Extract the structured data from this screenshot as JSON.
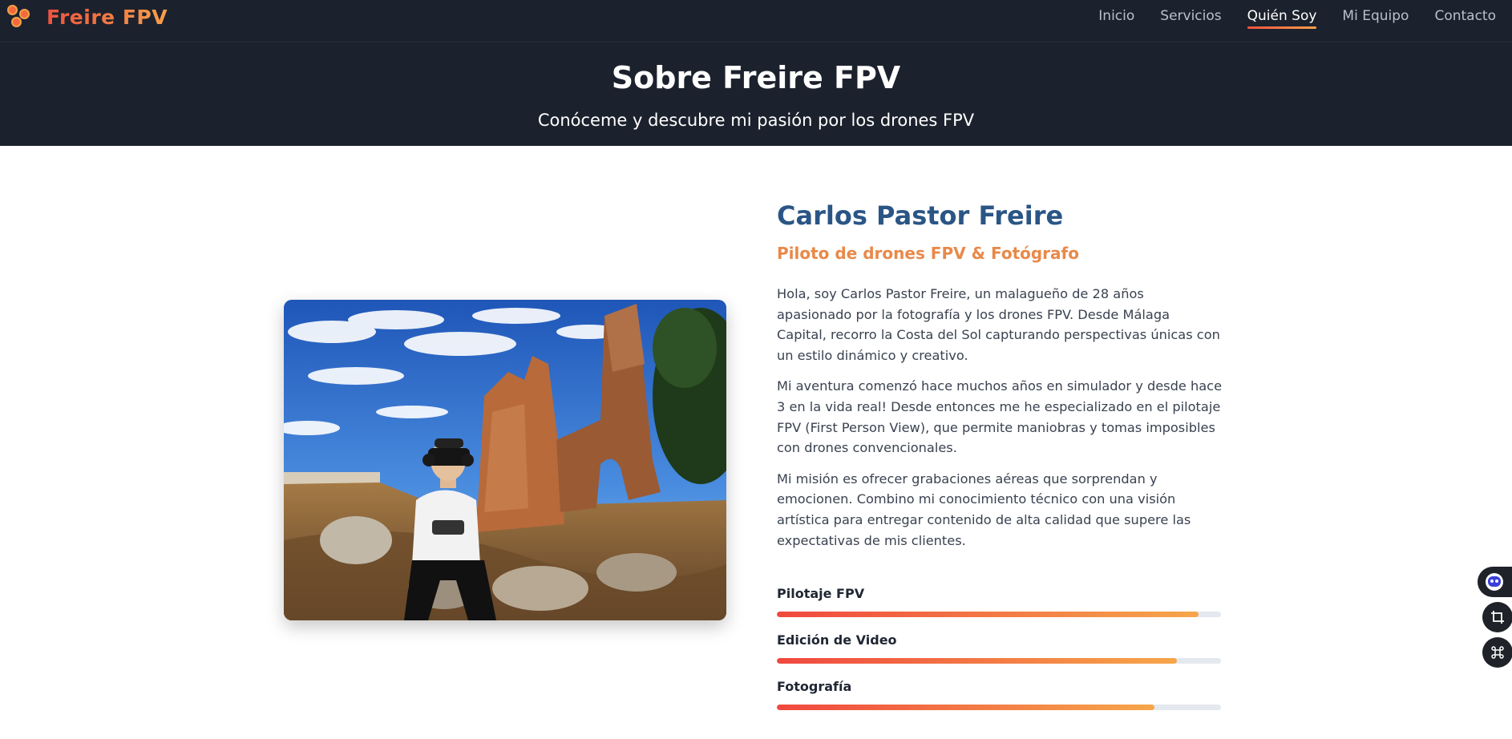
{
  "brand": {
    "name": "Freire FPV",
    "icon": "drone-logo-icon",
    "accent": "#f26a3c"
  },
  "nav": {
    "items": [
      {
        "label": "Inicio",
        "active": false
      },
      {
        "label": "Servicios",
        "active": false
      },
      {
        "label": "Quién Soy",
        "active": true
      },
      {
        "label": "Mi Equipo",
        "active": false
      },
      {
        "label": "Contacto",
        "active": false
      }
    ]
  },
  "hero": {
    "title": "Sobre Freire FPV",
    "subtitle": "Conóceme y descubre mi pasión por los drones FPV"
  },
  "about": {
    "name": "Carlos Pastor Freire",
    "role": "Piloto de drones FPV & Fotógrafo",
    "paragraphs": [
      "Hola, soy Carlos Pastor Freire, un malagueño de 28 años apasionado por la fotografía y los drones FPV. Desde Málaga Capital, recorro la Costa del Sol capturando perspectivas únicas con un estilo dinámico y creativo.",
      "Mi aventura comenzó hace muchos años en simulador y desde hace 3 en la vida real! Desde entonces me he especializado en el pilotaje FPV (First Person View), que permite maniobras y tomas imposibles con drones convencionales.",
      "Mi misión es ofrecer grabaciones aéreas que sorprendan y emocionen. Combino mi conocimiento técnico con una visión artística para entregar contenido de alta calidad que supere las expectativas de mis clientes."
    ],
    "photo_subject": "pilot-with-fpv-goggles-in-ruins",
    "skills": [
      {
        "label": "Pilotaje FPV",
        "level": 0.95
      },
      {
        "label": "Edición de Video",
        "level": 0.9
      },
      {
        "label": "Fotografía",
        "level": 0.85
      }
    ]
  },
  "floating_tools": [
    {
      "icon": "assistant-bot-icon"
    },
    {
      "icon": "crop-icon"
    },
    {
      "icon": "command-icon"
    }
  ],
  "colors": {
    "header_bg": "#1c222d",
    "name_blue": "#2a5585",
    "role_orange": "#e8894a",
    "gradient_start": "#f0483f",
    "gradient_end": "#f6a64a"
  }
}
